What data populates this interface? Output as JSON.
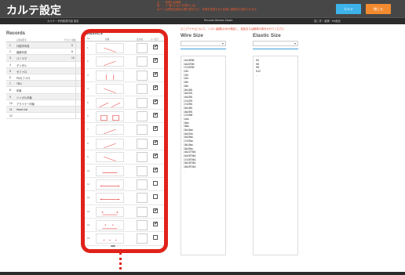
{
  "header": {
    "title": "カルテ設定",
    "notes": [
      "カ・・ 変更を反映時",
      "保・・ (一番上にはしを表示しま)",
      "ｶﾙﾃｴ とは現在記録品の現行表示です。 状態を変更すると記録に最終的に保存されます。"
    ],
    "karte_button": "カルテ",
    "close_button": "閉じる"
  },
  "subbar": {
    "left_label": "カルテ・予約録書内容 設定",
    "middle_label": "Records   Wireless   Elastic",
    "right_label": "頂こ作・装置・Re設定"
  },
  "instruction": "ひこ(ワイヤ)について、リスト(装置)のほか指定し、追加または削除の事をかけてください",
  "records": {
    "title": "Records",
    "columns": [
      "記録項目名",
      "ブラスト価格"
    ],
    "items": [
      {
        "num": "1",
        "name": "口腔内写真",
        "val": "6"
      },
      {
        "num": "2",
        "name": "顔面写真",
        "val": "6"
      },
      {
        "num": "3",
        "name": "パノラマ",
        "val": "12"
      },
      {
        "num": "4",
        "name": "デンタル",
        "val": ""
      },
      {
        "num": "5",
        "name": "セファロ",
        "val": ""
      },
      {
        "num": "6",
        "name": "PAセファロ",
        "val": ""
      },
      {
        "num": "7",
        "name": "TBU",
        "val": ""
      },
      {
        "num": "8",
        "name": "印象",
        "val": ""
      },
      {
        "num": "9",
        "name": "シンガル印象",
        "val": ""
      },
      {
        "num": "10",
        "name": "アライナー印象",
        "val": ""
      },
      {
        "num": "11",
        "name": "Head List",
        "val": ""
      },
      {
        "num": "12",
        "name": "",
        "val": ""
      }
    ]
  },
  "elastics": {
    "title": "Elastics",
    "columns": [
      "No.",
      "画像",
      "表示幅",
      "よく使う"
    ],
    "items": [
      {
        "idx": "1",
        "checked": true,
        "icon": "diagonal-down"
      },
      {
        "idx": "2",
        "checked": true,
        "icon": "diagonal-up"
      },
      {
        "idx": "3",
        "checked": true,
        "icon": "vertical-pair"
      },
      {
        "idx": "4",
        "checked": true,
        "icon": "diagonal-down"
      },
      {
        "idx": "5",
        "checked": true,
        "icon": "double-diagonal"
      },
      {
        "idx": "6",
        "checked": true,
        "icon": "box-pair"
      },
      {
        "idx": "7",
        "checked": true,
        "icon": "diagonal-up"
      },
      {
        "idx": "8",
        "checked": true,
        "icon": "diagonal-up"
      },
      {
        "idx": "9",
        "checked": true,
        "icon": "diagonal-down"
      },
      {
        "idx": "10",
        "checked": true,
        "icon": "horizontal"
      },
      {
        "idx": "11",
        "checked": false,
        "icon": "horizontal-dots"
      },
      {
        "idx": "12",
        "checked": false,
        "icon": "horizontal-dots"
      },
      {
        "idx": "13",
        "checked": true,
        "icon": "dots-pair"
      },
      {
        "idx": "14",
        "checked": true,
        "icon": "triangle-dots"
      },
      {
        "idx": "15",
        "checked": false,
        "icon": "short-dots"
      }
    ]
  },
  "wire_size": {
    "title": "Wire Size",
    "dropdown_value": "",
    "items": [
      "14x18SM",
      "16x22SM",
      "17x25SM",
      "10N",
      "12N",
      "14N",
      "16N",
      "18N",
      "16x16N",
      "16x22N",
      "16x25N",
      "17x22N",
      "17x25N",
      "18x18N",
      "18x25N",
      "17x25M",
      "14ss",
      "16ss",
      "18ss",
      "16x16ss",
      "16x22ss",
      "16x25ss",
      "17x25ss",
      "18x18ss",
      "18x25ss",
      "16x22TMA",
      "16x25TMA",
      "17x25TMA",
      "18x18TMA",
      "18x25TMA",
      "-"
    ]
  },
  "elastic_size": {
    "title": "Elastic Size",
    "dropdown_value": "",
    "items": [
      "H4",
      "H6",
      "H8",
      "H12",
      "-"
    ]
  },
  "colors": {
    "accent_blue": "#3db3ea",
    "accent_orange": "#f28a30",
    "highlight_red": "#e0221a",
    "topbar": "#474747"
  }
}
